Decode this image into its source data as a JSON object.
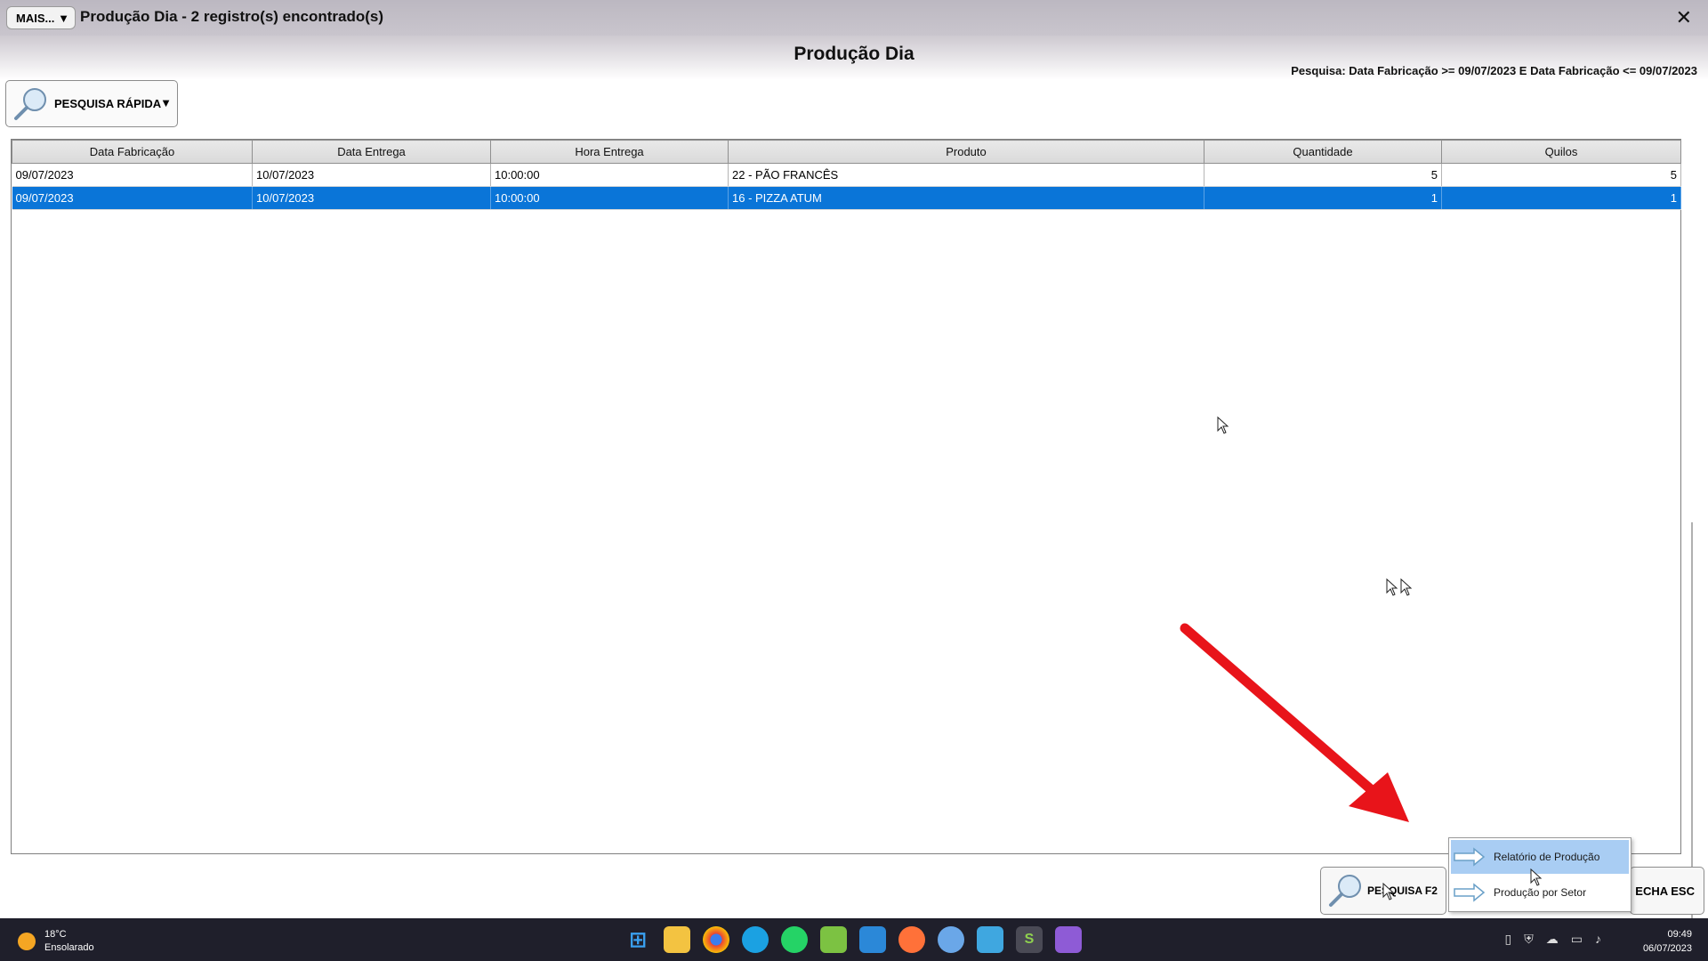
{
  "window": {
    "mais_label": "MAIS...",
    "title": "Produção Dia - 2 registro(s) encontrado(s)",
    "close": "✕"
  },
  "header": {
    "title": "Produção Dia",
    "criteria": "Pesquisa: Data Fabricação >= 09/07/2023 E Data Fabricação <= 09/07/2023"
  },
  "quick_search": {
    "label": "PESQUISA RÁPIDA",
    "arrow": "▼"
  },
  "table": {
    "columns": [
      "Data Fabricação",
      "Data Entrega",
      "Hora Entrega",
      "Produto",
      "Quantidade",
      "Quilos"
    ],
    "rows": [
      [
        "09/07/2023",
        "10/07/2023",
        "10:00:00",
        "22 - PÃO FRANCÊS",
        "5",
        "5"
      ],
      [
        "09/07/2023",
        "10/07/2023",
        "10:00:00",
        "16 - PIZZA ATUM",
        "1",
        "1"
      ]
    ]
  },
  "buttons": {
    "pesquisa": "PESQUISA F2",
    "fecha": "ECHA ESC"
  },
  "popup": {
    "items": [
      "Relatório de Produção",
      "Produção por Setor"
    ]
  },
  "taskbar": {
    "temp": "18°C",
    "weather": "Ensolarado",
    "time": "09:49",
    "date": "06/07/2023"
  },
  "colors": {
    "selection": "#0a75d8",
    "menu_highlight": "#a9cdf3",
    "arrow": "#e8141a"
  }
}
